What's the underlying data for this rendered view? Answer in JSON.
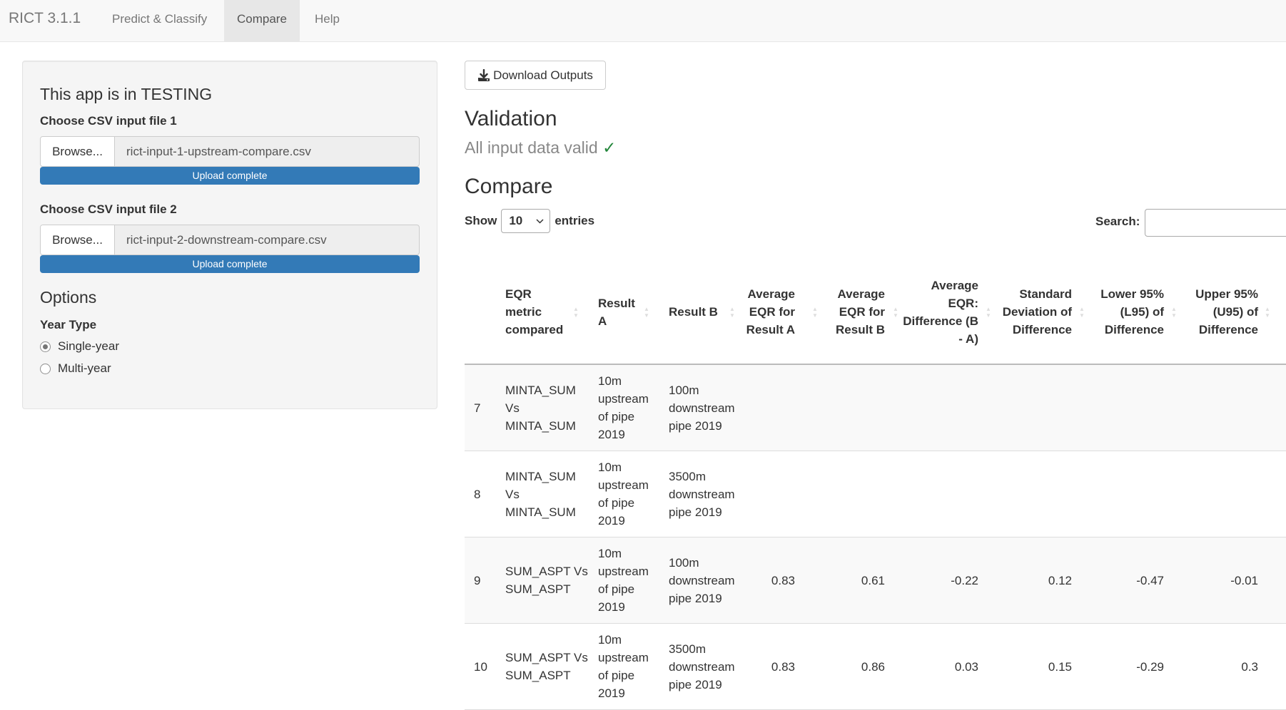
{
  "navbar": {
    "brand": "RICT 3.1.1",
    "tabs": [
      {
        "label": "Predict & Classify",
        "active": false
      },
      {
        "label": "Compare",
        "active": true
      },
      {
        "label": "Help",
        "active": false
      }
    ]
  },
  "sidebar": {
    "title": "This app is in TESTING",
    "file1": {
      "label": "Choose CSV input file 1",
      "browse_label": "Browse...",
      "filename": "rict-input-1-upstream-compare.csv",
      "progress_label": "Upload complete",
      "progress_percent": 100
    },
    "file2": {
      "label": "Choose CSV input file 2",
      "browse_label": "Browse...",
      "filename": "rict-input-2-downstream-compare.csv",
      "progress_label": "Upload complete",
      "progress_percent": 100
    },
    "options_title": "Options",
    "year_type": {
      "label": "Year Type",
      "options": [
        {
          "label": "Single-year",
          "checked": true
        },
        {
          "label": "Multi-year",
          "checked": false
        }
      ]
    }
  },
  "main": {
    "download_label": "Download Outputs",
    "download_icon": "download-icon",
    "validation_title": "Validation",
    "validation_text": "All input data valid",
    "validation_check": "✓",
    "validation_check_color": "#22863a",
    "compare_title": "Compare",
    "show_label": "Show",
    "entries_label": "entries",
    "page_length": "10",
    "search_label": "Search:",
    "search_value": ""
  },
  "table": {
    "columns": [
      "",
      "EQR metric compared",
      "Result A",
      "Result B",
      "Average EQR for Result A",
      "Average EQR for Result B",
      "Average EQR: Difference (B - A)",
      "Standard Deviation of Difference",
      "Lower 95% (L95) of Difference",
      "Upper 95% (U95) of Difference"
    ],
    "rows": [
      {
        "index": "7",
        "metric": "MINTA_SUM Vs MINTA_SUM",
        "result_a": "10m upstream of pipe 2019",
        "result_b": "100m downstream pipe 2019",
        "avg_a": "",
        "avg_b": "",
        "diff": "",
        "sd": "",
        "l95": "",
        "u95": ""
      },
      {
        "index": "8",
        "metric": "MINTA_SUM Vs MINTA_SUM",
        "result_a": "10m upstream of pipe 2019",
        "result_b": "3500m downstream pipe 2019",
        "avg_a": "",
        "avg_b": "",
        "diff": "",
        "sd": "",
        "l95": "",
        "u95": ""
      },
      {
        "index": "9",
        "metric": "SUM_ASPT Vs SUM_ASPT",
        "result_a": "10m upstream of pipe 2019",
        "result_b": "100m downstream pipe 2019",
        "avg_a": "0.83",
        "avg_b": "0.61",
        "diff": "-0.22",
        "sd": "0.12",
        "l95": "-0.47",
        "u95": "-0.01"
      },
      {
        "index": "10",
        "metric": "SUM_ASPT Vs SUM_ASPT",
        "result_a": "10m upstream of pipe 2019",
        "result_b": "3500m downstream pipe 2019",
        "avg_a": "0.83",
        "avg_b": "0.86",
        "diff": "0.03",
        "sd": "0.15",
        "l95": "-0.29",
        "u95": "0.3"
      }
    ]
  }
}
